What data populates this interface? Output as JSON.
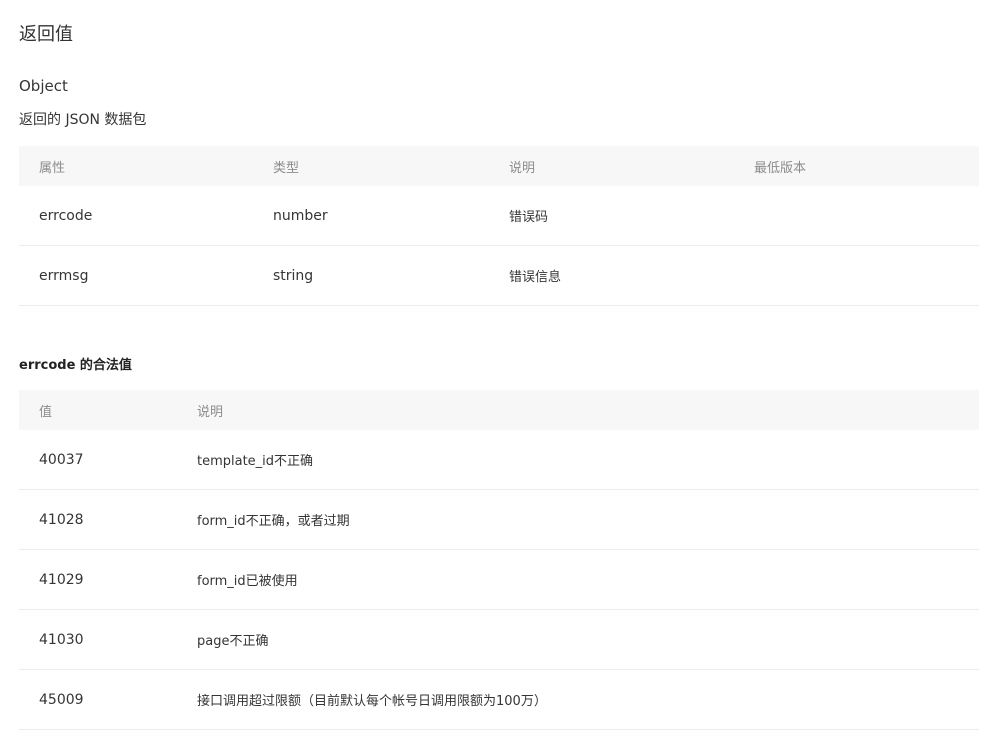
{
  "section": {
    "title": "返回值",
    "type": "Object",
    "description": "返回的 JSON 数据包"
  },
  "props_table": {
    "headers": [
      "属性",
      "类型",
      "说明",
      "最低版本"
    ],
    "rows": [
      {
        "name": "errcode",
        "type": "number",
        "desc": "错误码",
        "version": ""
      },
      {
        "name": "errmsg",
        "type": "string",
        "desc": "错误信息",
        "version": ""
      }
    ]
  },
  "errcode_section": {
    "title": "errcode 的合法值"
  },
  "errcode_table": {
    "headers": [
      "值",
      "说明"
    ],
    "rows": [
      {
        "value": "40037",
        "desc": "template_id不正确"
      },
      {
        "value": "41028",
        "desc": "form_id不正确，或者过期"
      },
      {
        "value": "41029",
        "desc": "form_id已被使用"
      },
      {
        "value": "41030",
        "desc": "page不正确"
      },
      {
        "value": "45009",
        "desc": "接口调用超过限额（目前默认每个帐号日调用限额为100万）"
      }
    ]
  }
}
